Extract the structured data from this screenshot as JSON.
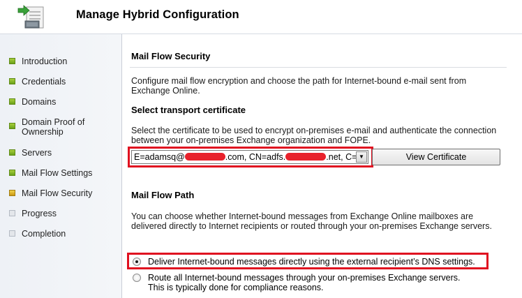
{
  "window": {
    "title": "Manage Hybrid Configuration"
  },
  "sidebar": {
    "steps": [
      {
        "label": "Introduction",
        "state": "done"
      },
      {
        "label": "Credentials",
        "state": "done"
      },
      {
        "label": "Domains",
        "state": "done"
      },
      {
        "label": "Domain Proof of Ownership",
        "state": "done"
      },
      {
        "label": "Servers",
        "state": "done"
      },
      {
        "label": "Mail Flow Settings",
        "state": "done"
      },
      {
        "label": "Mail Flow Security",
        "state": "current"
      },
      {
        "label": "Progress",
        "state": "pending"
      },
      {
        "label": "Completion",
        "state": "pending"
      }
    ]
  },
  "main": {
    "title": "Mail Flow Security",
    "description": "Configure mail flow encryption and choose the path for Internet-bound e-mail sent from Exchange Online.",
    "transport": {
      "heading": "Select transport certificate",
      "description": "Select the certificate to be used to encrypt on-premises e-mail and authenticate the connection between your on-premises Exchange organization and FOPE.",
      "certificate_prefix": "E=adamsq@",
      "certificate_mid": ".com, CN=adfs.",
      "certificate_suffix": ".net, C=C",
      "view_button": "View Certificate"
    },
    "mail_flow_path": {
      "heading": "Mail Flow Path",
      "description": "You can choose whether Internet-bound messages from Exchange Online mailboxes are delivered directly to Internet recipients or routed through your on-premises Exchange servers.",
      "option_direct": "Deliver Internet-bound messages directly using the external recipient’s DNS settings.",
      "option_route_line1": "Route all Internet-bound messages through your on-premises Exchange servers.",
      "option_route_line2": "This is typically done for compliance reasons.",
      "selected": "direct"
    }
  },
  "colors": {
    "highlight": "#e01020",
    "step_done": "#7fb52a",
    "step_current": "#e0b020",
    "step_pending": "#d0d4da"
  }
}
